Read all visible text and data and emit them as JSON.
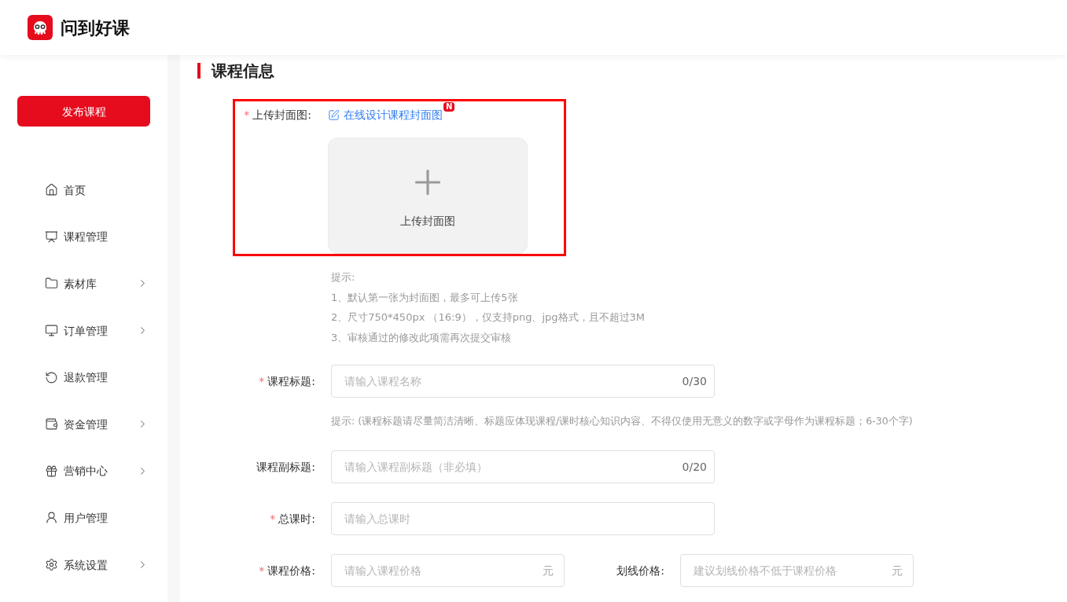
{
  "header": {
    "logo_text": "问到好课"
  },
  "sidebar": {
    "publish_button": "发布课程",
    "items": [
      {
        "label": "首页",
        "expandable": false
      },
      {
        "label": "课程管理",
        "expandable": false
      },
      {
        "label": "素材库",
        "expandable": true
      },
      {
        "label": "订单管理",
        "expandable": true
      },
      {
        "label": "退款管理",
        "expandable": false
      },
      {
        "label": "资金管理",
        "expandable": true
      },
      {
        "label": "营销中心",
        "expandable": true
      },
      {
        "label": "用户管理",
        "expandable": false
      },
      {
        "label": "系统设置",
        "expandable": true
      }
    ]
  },
  "section_title": "课程信息",
  "cover": {
    "required_mark": "*",
    "highlighted": true,
    "label": "上传封面图:",
    "design_link": "在线设计课程封面图",
    "badge": "N",
    "upload_text": "上传封面图",
    "tips": [
      "提示:",
      "1、默认第一张为封面图，最多可上传5张",
      "2、尺寸750*450px （16:9），仅支持png、jpg格式，且不超过3M",
      "3、审核通过的修改此项需再次提交审核"
    ]
  },
  "rows": [
    {
      "kind": "input",
      "label": "课程标题:",
      "required_mark": "*",
      "placeholder": "请输入课程名称",
      "counter": "0/30"
    },
    {
      "kind": "hint",
      "text": "提示: (课程标题请尽量简洁清晰、标题应体现课程/课时核心知识内容、不得仅使用无意义的数字或字母作为课程标题；6-30个字)"
    },
    {
      "kind": "input",
      "label": "课程副标题:",
      "placeholder": "请输入课程副标题（非必填）",
      "counter": "0/20"
    },
    {
      "kind": "input",
      "label": "总课时:",
      "required_mark": "*",
      "placeholder": "请输入总课时"
    },
    {
      "kind": "pair",
      "fields": [
        {
          "label": "课程价格:",
          "required_mark": "*",
          "placeholder": "请输入课程价格",
          "unit": "元"
        },
        {
          "label": "划线价格:",
          "placeholder": "建议划线价格不低于课程价格",
          "unit": "元"
        }
      ]
    }
  ]
}
